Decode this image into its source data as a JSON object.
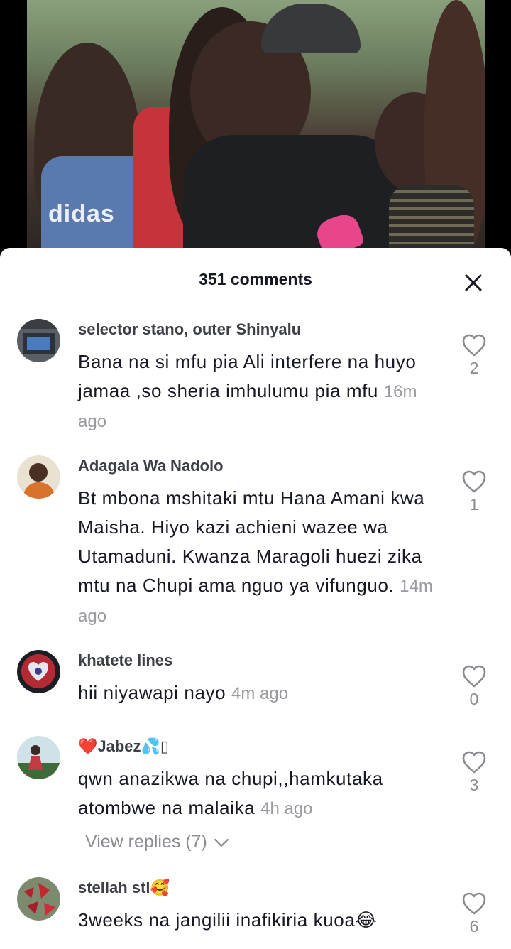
{
  "video": {
    "shirt_text": "didas"
  },
  "sheet": {
    "title": "351 comments"
  },
  "comments": [
    {
      "username": "selector stano, outer Shinyalu",
      "text": "Bana na si mfu pia Ali interfere na huyo jamaa ,so sheria imhulumu pia mfu",
      "time": "16m ago",
      "likes": "2"
    },
    {
      "username": "Adagala Wa Nadolo",
      "text": "Bt mbona mshitaki mtu Hana Amani kwa Maisha. Hiyo kazi achieni wazee wa Utamaduni. Kwanza Maragoli huezi zika mtu na Chupi ama nguo ya vifunguo.",
      "time": "14m ago",
      "likes": "1"
    },
    {
      "username": "khatete lines",
      "text": "hii niyawapi nayo",
      "time": "4m ago",
      "likes": "0"
    },
    {
      "username": "❤️Jabez💦▯",
      "text": "qwn anazikwa na chupi,,hamkutaka atombwe na malaika",
      "time": "4h ago",
      "likes": "3",
      "view_replies": "View replies (7)"
    },
    {
      "username": "stellah stl🥰",
      "text": "3weeks na jangilii inafikiria kuoa😂",
      "likes": "6"
    }
  ],
  "colors": {
    "like_outline": "#8a8b91",
    "username": "#3d3f46",
    "text": "#161823"
  },
  "icons": {
    "close": "close-icon",
    "like": "heart-outline-icon",
    "chevron": "chevron-down-icon"
  }
}
